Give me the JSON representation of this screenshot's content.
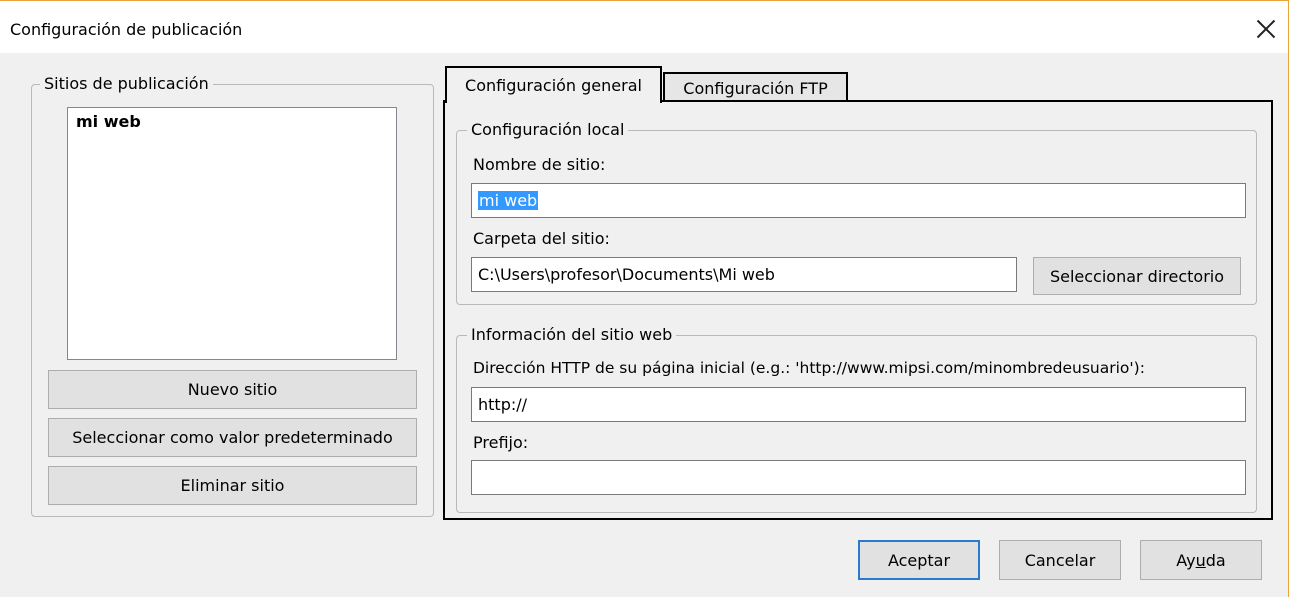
{
  "window": {
    "title": "Configuración de publicación"
  },
  "sites_panel": {
    "legend": "Sitios de publicación",
    "items": [
      "mi web"
    ],
    "buttons": {
      "new_site": "Nuevo sitio",
      "set_default": "Seleccionar como valor predeterminado",
      "delete_site": "Eliminar sitio"
    }
  },
  "tabs": [
    "Configuración general",
    "Configuración FTP"
  ],
  "local_settings": {
    "legend": "Configuración local",
    "site_name_label": "Nombre de sitio:",
    "site_name_value": "mi web",
    "site_folder_label": "Carpeta del sitio:",
    "site_folder_value": "C:\\Users\\profesor\\Documents\\Mi web",
    "select_dir_button": "Seleccionar directorio"
  },
  "website_info": {
    "legend": "Información del sitio web",
    "http_label": "Dirección HTTP de su página inicial (e.g.: 'http://www.mipsi.com/minombredeusuario'):",
    "http_value": "http://",
    "prefix_label": "Prefijo:",
    "prefix_value": ""
  },
  "footer": {
    "ok": "Aceptar",
    "cancel": "Cancelar",
    "help_prefix": "Ay",
    "help_underlined": "u",
    "help_suffix": "da"
  },
  "colors": {
    "accent": "#2a7ad2",
    "selection": "#3399ff",
    "window_border": "#e8a33b"
  }
}
